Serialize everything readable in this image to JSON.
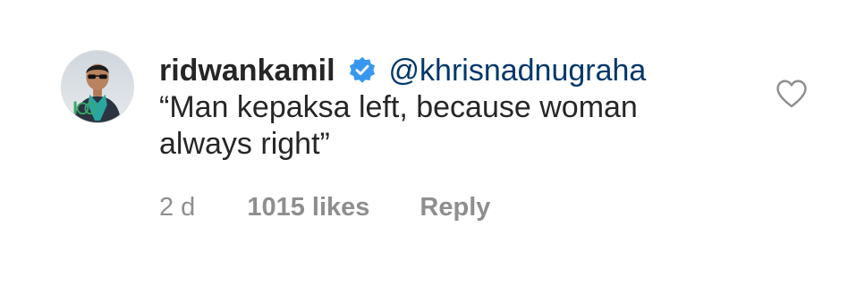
{
  "comment": {
    "username": "ridwankamil",
    "verified_icon": "verified-badge-icon",
    "mention": "@khrisnadnugraha",
    "text": "“Man kepaksa left, because woman always right”",
    "time": "2 d",
    "likes": "1015 likes",
    "reply_label": "Reply",
    "like_icon": "heart-outline-icon",
    "avatar": "profile-photo"
  },
  "colors": {
    "text": "#262626",
    "muted": "#8e8e8e",
    "mention": "#00376b",
    "verified": "#3897f0"
  }
}
